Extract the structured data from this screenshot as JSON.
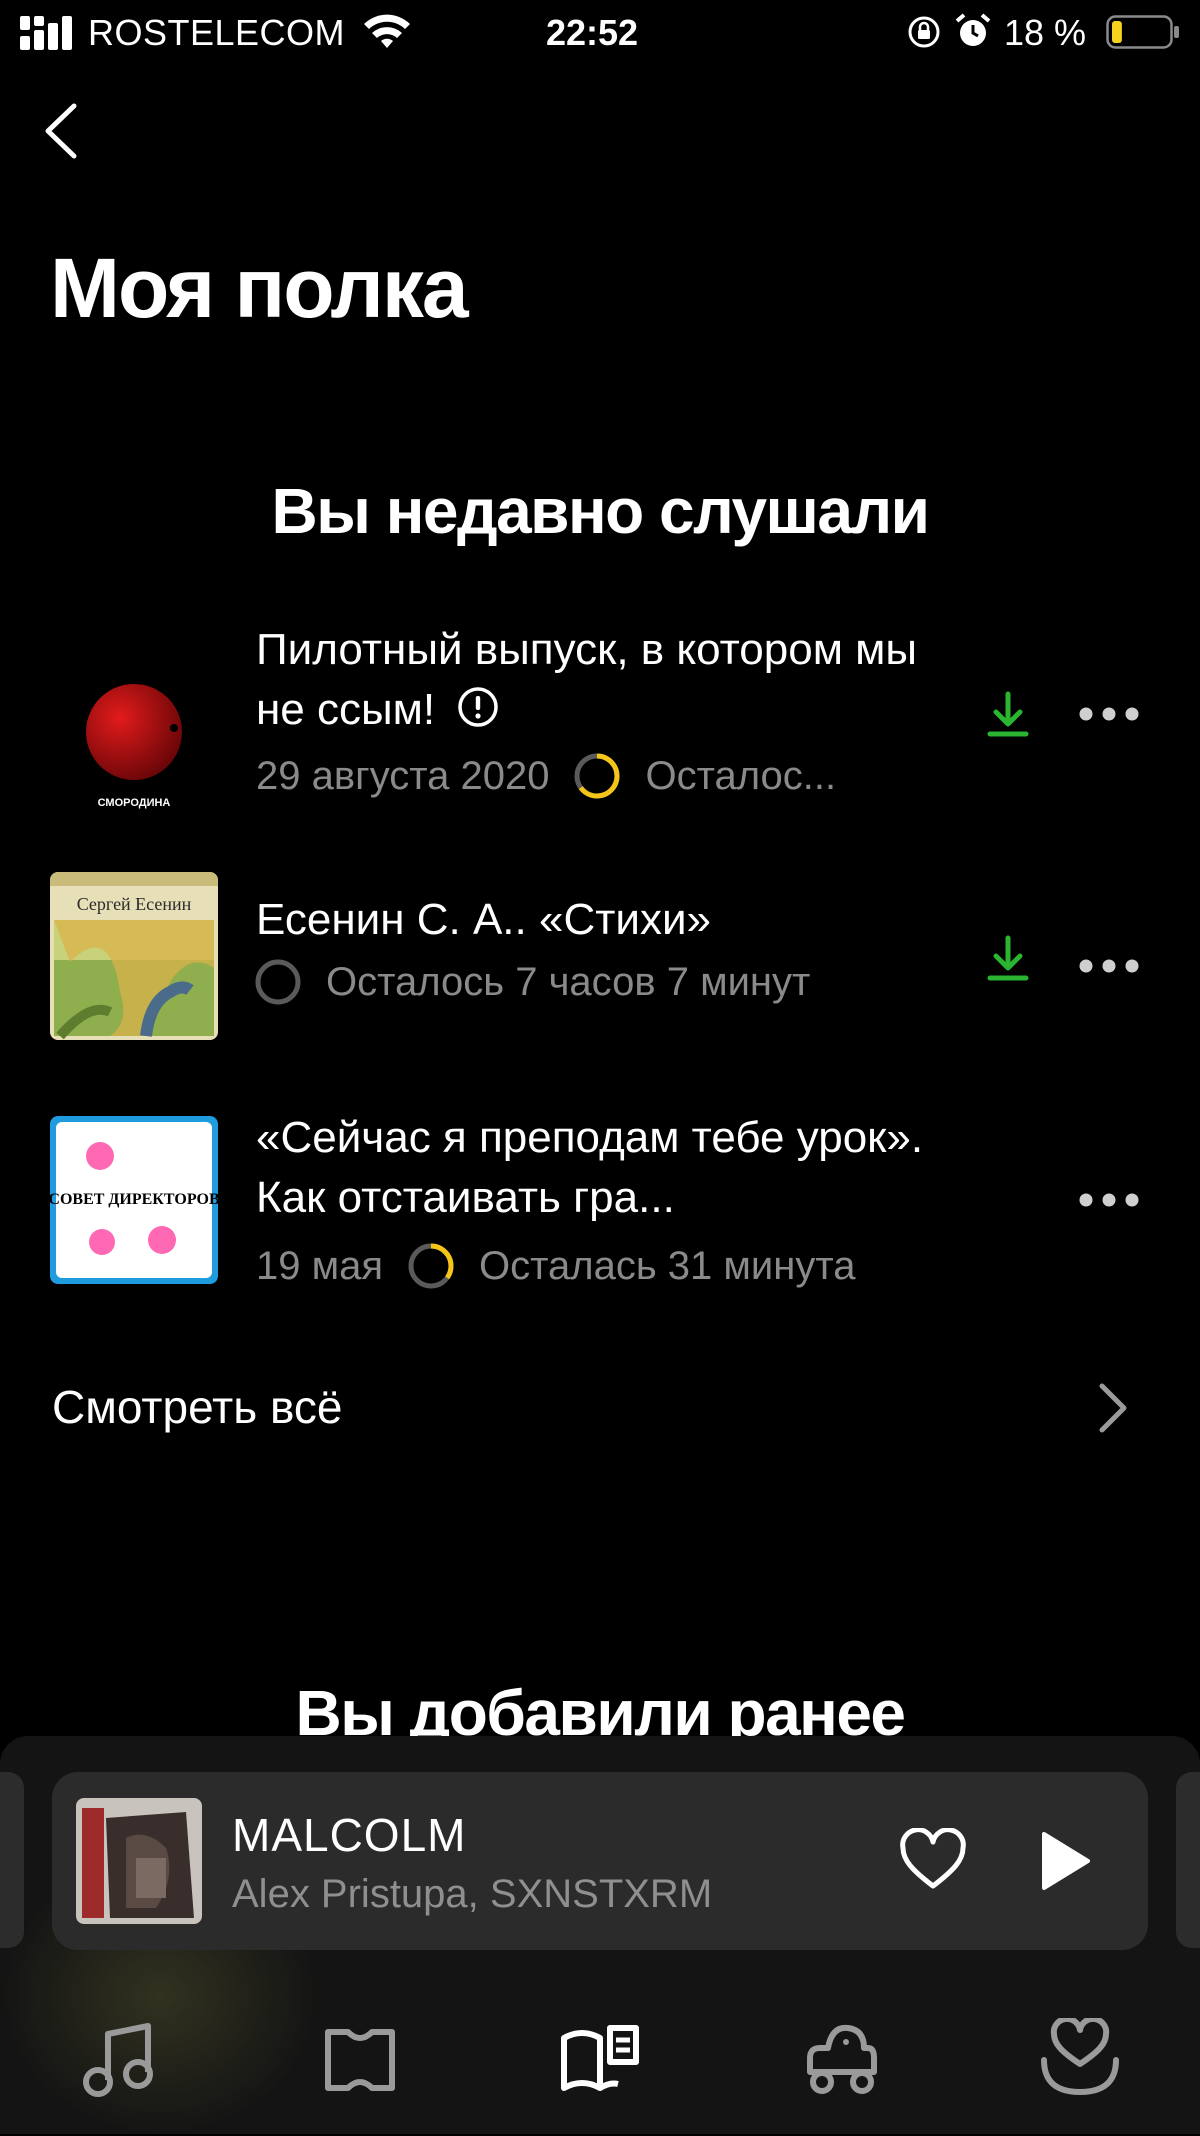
{
  "status_bar": {
    "carrier": "ROSTELECOM",
    "time": "22:52",
    "battery": "18 %",
    "battery_level": 0.18,
    "battery_color": "#f5d21e"
  },
  "header": {
    "back_icon": "chevron-left-icon",
    "title": "Моя полка"
  },
  "recent": {
    "title": "Вы недавно слушали",
    "items": [
      {
        "cover_caption": "СМОРОДИНА",
        "title": "Пилотный выпуск, в котором мы не ссым!",
        "explicit_icon": "explicit-icon",
        "date": "29 августа 2020",
        "progress": 0.65,
        "remaining": "Осталос...",
        "downloaded": true
      },
      {
        "cover_caption": "Сергей Есенин",
        "title": "Есенин С. А.. «Стихи»",
        "progress": 0,
        "remaining": "Осталось 7 часов 7 минут",
        "downloaded": true
      },
      {
        "cover_caption": "СОВЕТ ДИРЕКТОРОВ",
        "title": "«Сейчас я преподам тебе урок». Как отстаивать гра...",
        "date": "19 мая",
        "progress": 0.35,
        "remaining": "Осталась 31 минута",
        "downloaded": false
      }
    ],
    "see_all": "Смотреть всё"
  },
  "added": {
    "title": "Вы добавили ранее"
  },
  "mini_player": {
    "title": "MALCOLM",
    "artist": "Alex Pristupa, SXNSTXRM",
    "like_icon": "heart-icon",
    "play_icon": "play-icon"
  },
  "tabbar": {
    "tabs": [
      {
        "icon": "music-note-icon",
        "active": false
      },
      {
        "icon": "map-icon",
        "active": false
      },
      {
        "icon": "book-icon",
        "active": true
      },
      {
        "icon": "kids-car-icon",
        "active": false
      },
      {
        "icon": "heart-tab-icon",
        "active": false
      }
    ]
  },
  "colors": {
    "background": "#000000",
    "accent_green": "#2bb42f",
    "progress_yellow": "#f5c518",
    "secondary_text": "#8a8a8a",
    "tab_icon": "#9a9a9a"
  }
}
